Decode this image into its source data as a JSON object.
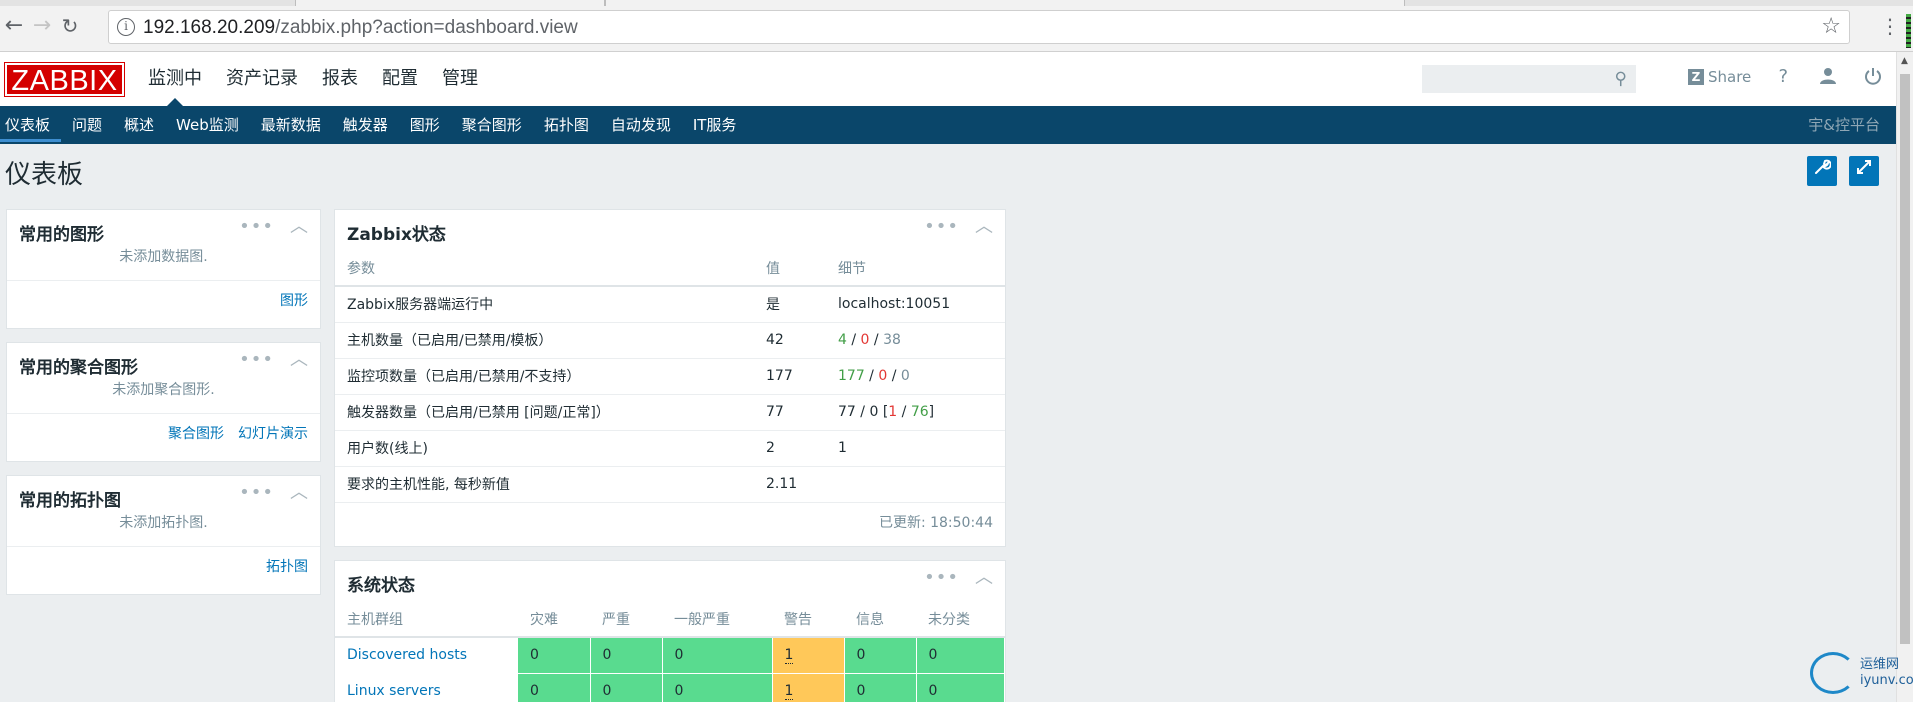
{
  "browser": {
    "url_host": "192.168.20.209",
    "url_path": "/zabbix.php?action=dashboard.view",
    "back_icon": "arrow-left",
    "forward_icon": "arrow-right",
    "reload_icon": "reload"
  },
  "header": {
    "logo": "ZABBIX",
    "menu": [
      {
        "label": "监测中"
      },
      {
        "label": "资产记录"
      },
      {
        "label": "报表"
      },
      {
        "label": "配置"
      },
      {
        "label": "管理"
      }
    ],
    "search_placeholder": "",
    "share_label": "Share",
    "help_label": "?"
  },
  "subnav": {
    "items": [
      {
        "label": "仪表板"
      },
      {
        "label": "问题"
      },
      {
        "label": "概述"
      },
      {
        "label": "Web监测"
      },
      {
        "label": "最新数据"
      },
      {
        "label": "触发器"
      },
      {
        "label": "图形"
      },
      {
        "label": "聚合图形"
      },
      {
        "label": "拓扑图"
      },
      {
        "label": "自动发现"
      },
      {
        "label": "IT服务"
      }
    ],
    "brand": "宇&控平台"
  },
  "page": {
    "title": "仪表板"
  },
  "widgets": {
    "fav_graphs": {
      "title": "常用的图形",
      "empty": "未添加数据图.",
      "link": "图形"
    },
    "fav_screens": {
      "title": "常用的聚合图形",
      "empty": "未添加聚合图形.",
      "link1": "聚合图形",
      "link2": "幻灯片演示"
    },
    "fav_maps": {
      "title": "常用的拓扑图",
      "empty": "未添加拓扑图.",
      "link": "拓扑图"
    },
    "zabbix_status": {
      "title": "Zabbix状态",
      "headers": [
        "参数",
        "值",
        "细节"
      ],
      "rows": [
        {
          "param": "Zabbix服务器端运行中",
          "value": "是",
          "detail": "localhost:10051"
        },
        {
          "param": "主机数量（已启用/已禁用/模板）",
          "value": "42",
          "d1": "4",
          "d2": "0",
          "d3": "38"
        },
        {
          "param": "监控项数量（已启用/已禁用/不支持）",
          "value": "177",
          "d1": "177",
          "d2": "0",
          "d3": "0"
        },
        {
          "param": "触发器数量（已启用/已禁用 [问题/正常]）",
          "value": "77",
          "d1": "77",
          "d2": "0",
          "d3": "1",
          "d4": "76"
        },
        {
          "param": "用户数(线上)",
          "value": "2",
          "detail": "1"
        },
        {
          "param": "要求的主机性能, 每秒新值",
          "value": "2.11",
          "detail": ""
        }
      ],
      "updated": "已更新: 18:50:44"
    },
    "system_status": {
      "title": "系统状态",
      "headers": [
        "主机群组",
        "灾难",
        "严重",
        "一般严重",
        "警告",
        "信息",
        "未分类"
      ],
      "rows": [
        {
          "group": "Discovered hosts",
          "disaster": "0",
          "high": "0",
          "average": "0",
          "warning": "1",
          "info": "0",
          "na": "0"
        },
        {
          "group": "Linux servers",
          "disaster": "0",
          "high": "0",
          "average": "0",
          "warning": "1",
          "info": "0",
          "na": "0"
        }
      ]
    }
  },
  "watermark": {
    "line1": "运维网",
    "line2": "iyunv.com"
  },
  "colors": {
    "brand_red": "#d40000",
    "nav_blue": "#0a466a",
    "ok_green": "#59db8f",
    "warning_amber": "#ffc859",
    "link_blue": "#0275b8"
  }
}
